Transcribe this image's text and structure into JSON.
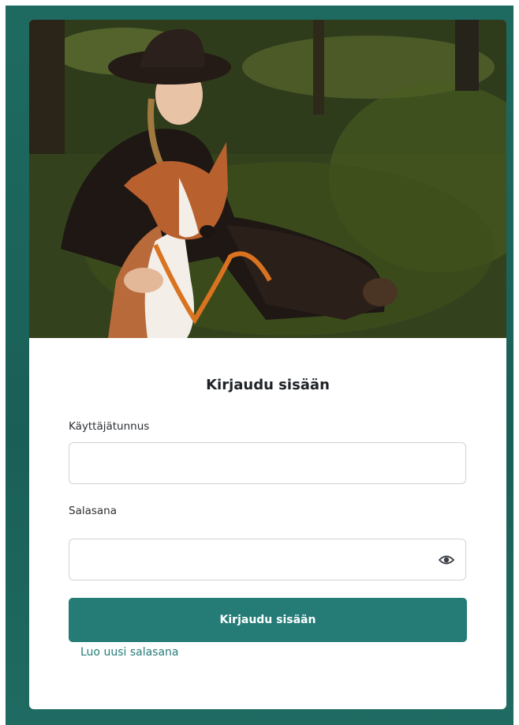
{
  "login": {
    "title": "Kirjaudu sisään",
    "username_label": "Käyttäjätunnus",
    "username_value": "",
    "password_label": "Salasana",
    "password_value": "",
    "submit_label": "Kirjaudu sisään",
    "forgot_link": "Luo uusi salasana"
  },
  "icons": {
    "password_toggle": "eye-icon"
  },
  "colors": {
    "frame": "#1e6a61",
    "primary": "#257c77",
    "card": "#ffffff"
  }
}
